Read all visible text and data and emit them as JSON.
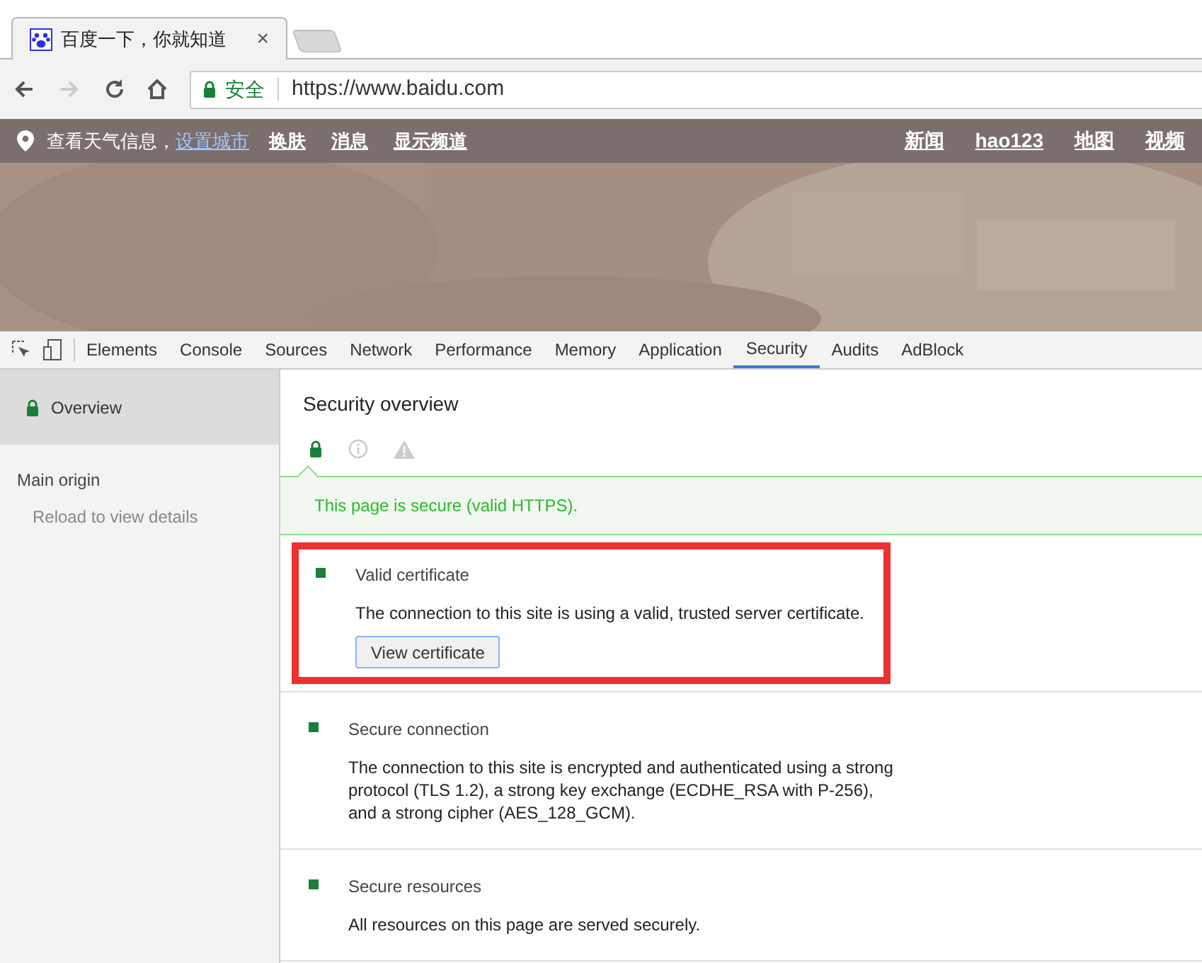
{
  "browser_tab": {
    "title": "百度一下，你就知道",
    "close": "×"
  },
  "address_bar": {
    "security_label": "安全",
    "url": "https://www.baidu.com"
  },
  "site_nav": {
    "left": [
      {
        "label": "查看天气信息，",
        "kind": "text"
      },
      {
        "label": "设置城市",
        "kind": "link-blue"
      },
      {
        "label": "换肤",
        "kind": "link"
      },
      {
        "label": "消息",
        "kind": "link"
      },
      {
        "label": "显示频道",
        "kind": "link"
      }
    ],
    "right": [
      {
        "label": "新闻"
      },
      {
        "label": "hao123"
      },
      {
        "label": "地图"
      },
      {
        "label": "视频"
      }
    ]
  },
  "devtools_tabs": [
    {
      "label": "Elements",
      "selected": false
    },
    {
      "label": "Console",
      "selected": false
    },
    {
      "label": "Sources",
      "selected": false
    },
    {
      "label": "Network",
      "selected": false
    },
    {
      "label": "Performance",
      "selected": false
    },
    {
      "label": "Memory",
      "selected": false
    },
    {
      "label": "Application",
      "selected": false
    },
    {
      "label": "Security",
      "selected": true
    },
    {
      "label": "Audits",
      "selected": false
    },
    {
      "label": "AdBlock",
      "selected": false
    }
  ],
  "sidebar": {
    "overview": {
      "label": "Overview",
      "selected": true
    },
    "section_title": "Main origin",
    "hint": "Reload to view details"
  },
  "overview": {
    "title": "Security overview",
    "status": "This page is secure (valid HTTPS).",
    "sections": [
      {
        "title": "Valid certificate",
        "description": "The connection to this site is using a valid, trusted server certificate.",
        "button": "View certificate",
        "highlighted": true
      },
      {
        "title": "Secure connection",
        "description": "The connection to this site is encrypted and authenticated using a strong protocol (TLS 1.2), a strong key exchange (ECDHE_RSA with P-256), and a strong cipher (AES_128_GCM).",
        "highlighted": false
      },
      {
        "title": "Secure resources",
        "description": "All resources on this page are served securely.",
        "highlighted": false
      }
    ]
  }
}
